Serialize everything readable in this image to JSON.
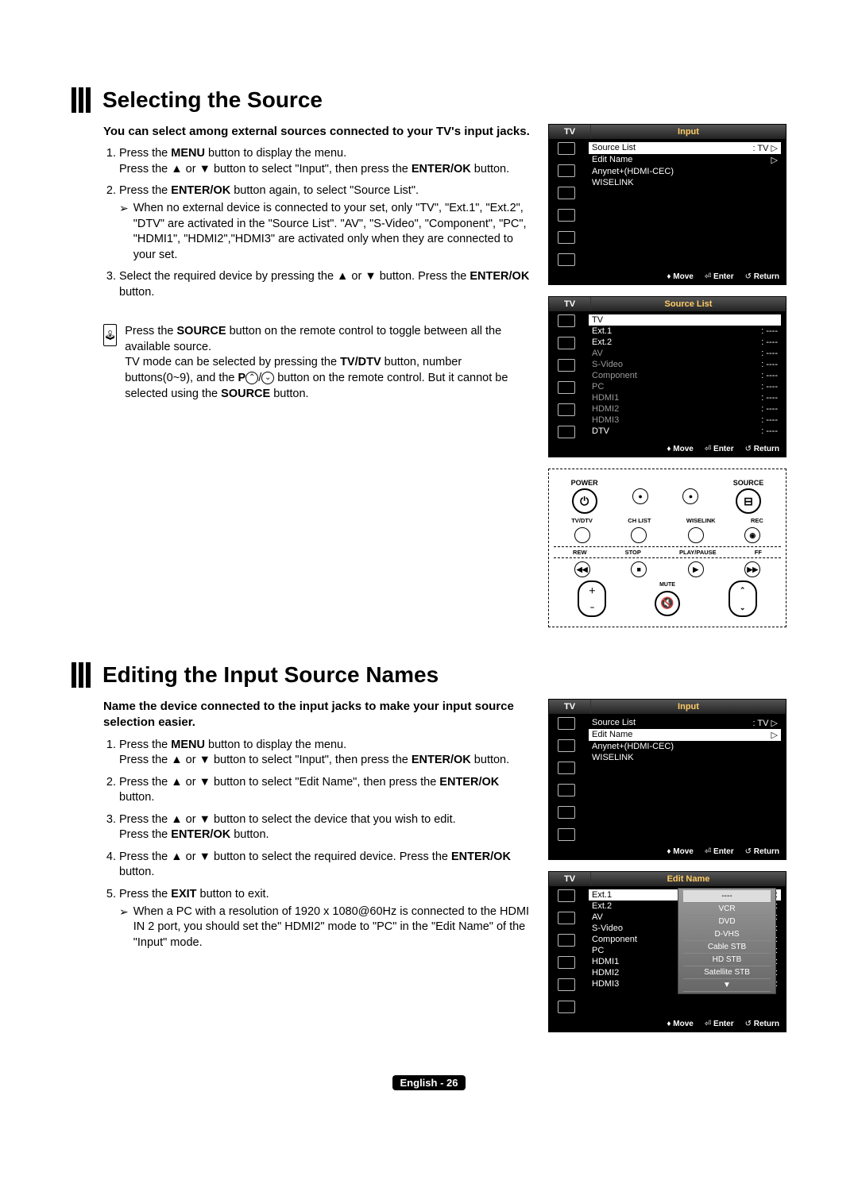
{
  "sec1": {
    "title": "Selecting the Source",
    "intro": "You can select among external sources connected to your TV's input jacks.",
    "step1a": "Press the ",
    "step1a_b": "MENU",
    "step1a2": " button to display the menu.",
    "step1b": "Press the ▲ or ▼ button to select \"Input\", then press the ",
    "step1b_b": "ENTER/OK",
    "step1b2": " button.",
    "step2a": "Press the ",
    "step2a_b": "ENTER/OK",
    "step2a2": " button again, to select \"Source List\".",
    "step2sub": "When no external device is connected to your set, only \"TV\", \"Ext.1\", \"Ext.2\", \"DTV\" are activated in the \"Source List\". \"AV\", \"S-Video\", \"Component\", \"PC\", \"HDMI1\", \"HDMI2\",\"HDMI3\" are activated only when they are connected to your set.",
    "step3a": "Select the required device by pressing the ▲ or ▼ button. Press the ",
    "step3a_b": "ENTER/OK",
    "step3a2": " button.",
    "note1a": "Press the ",
    "note1a_b": "SOURCE",
    "note1a2": " button on the remote control to toggle between all the available source.",
    "note1b1": "TV mode can be selected by pressing the ",
    "note1b1_b": "TV/DTV",
    "note1b2": " button, number buttons(0~9), and the ",
    "note1b2_b": "P",
    "note1b3": " button on the remote control. But it cannot be selected using the ",
    "note1b3_b": "SOURCE",
    "note1b4": " button."
  },
  "sec2": {
    "title": "Editing the Input Source Names",
    "intro": "Name the device connected to the input jacks to make your input source selection easier.",
    "step1a": "Press the ",
    "step1a_b": "MENU",
    "step1a2": " button to display the menu.",
    "step1b": "Press the ▲ or ▼ button to select \"Input\", then press the ",
    "step1b_b": "ENTER/OK",
    "step1b2": " button.",
    "step2": "Press the ▲ or ▼ button to select \"Edit Name\", then press the ",
    "step2_b": "ENTER/OK",
    "step2_2": " button.",
    "step3a": "Press the ▲ or ▼ button to select the device that you wish to edit.",
    "step3b": "Press the ",
    "step3b_b": "ENTER/OK",
    "step3b2": " button.",
    "step4": "Press the ▲ or ▼ button to select the required device. Press the ",
    "step4_b": "ENTER/OK",
    "step4_2": " button.",
    "step5": "Press the ",
    "step5_b": "EXIT",
    "step5_2": " button to exit.",
    "step5sub": "When a PC with a resolution of 1920 x 1080@60Hz is connected to the HDMI IN 2 port, you should set the\" HDMI2\" mode to \"PC\" in the \"Edit Name\" of the \"Input\" mode."
  },
  "osd": {
    "tv": "TV",
    "input_title": "Input",
    "source_list_title": "Source List",
    "edit_name_title": "Edit Name",
    "items_input": [
      {
        "label": "Source List",
        "val": ": TV",
        "tri": true,
        "hl": true
      },
      {
        "label": "Edit Name",
        "val": "",
        "tri": true
      },
      {
        "label": "Anynet+(HDMI-CEC)",
        "val": ""
      },
      {
        "label": "WISELINK",
        "val": ""
      }
    ],
    "items_srclist": [
      {
        "label": "TV",
        "val": "",
        "hl": true
      },
      {
        "label": "Ext.1",
        "val": ":   ----"
      },
      {
        "label": "Ext.2",
        "val": ":   ----"
      },
      {
        "label": "AV",
        "val": ":   ----",
        "grey": true
      },
      {
        "label": "S-Video",
        "val": ":   ----",
        "grey": true
      },
      {
        "label": "Component",
        "val": ":   ----",
        "grey": true
      },
      {
        "label": "PC",
        "val": ":   ----",
        "grey": true
      },
      {
        "label": "HDMI1",
        "val": ":   ----",
        "grey": true
      },
      {
        "label": "HDMI2",
        "val": ":   ----",
        "grey": true
      },
      {
        "label": "HDMI3",
        "val": ":   ----",
        "grey": true
      },
      {
        "label": "DTV",
        "val": ":   ----"
      }
    ],
    "items_input2": [
      {
        "label": "Source List",
        "val": ": TV",
        "tri": true
      },
      {
        "label": "Edit Name",
        "val": "",
        "tri": true,
        "hl": true
      },
      {
        "label": "Anynet+(HDMI-CEC)",
        "val": ""
      },
      {
        "label": "WISELINK",
        "val": ""
      }
    ],
    "items_editname": [
      {
        "label": "Ext.1",
        "val": ":",
        "hl": true
      },
      {
        "label": "Ext.2",
        "val": ":"
      },
      {
        "label": "AV",
        "val": ":"
      },
      {
        "label": "S-Video",
        "val": ":"
      },
      {
        "label": "Component",
        "val": ":"
      },
      {
        "label": "PC",
        "val": ":"
      },
      {
        "label": "HDMI1",
        "val": ":"
      },
      {
        "label": "HDMI2",
        "val": ":"
      },
      {
        "label": "HDMI3",
        "val": ":"
      }
    ],
    "dropdown": [
      "----",
      "VCR",
      "DVD",
      "D-VHS",
      "Cable STB",
      "HD STB",
      "Satellite STB",
      "▼"
    ],
    "move": "Move",
    "enter": "Enter",
    "return": "Return"
  },
  "remote": {
    "power": "POWER",
    "source": "SOURCE",
    "row2": [
      "TV/DTV",
      "CH LIST",
      "WISELINK",
      "REC"
    ],
    "row3": [
      "REW",
      "STOP",
      "PLAY/PAUSE",
      "FF"
    ],
    "mute": "MUTE"
  },
  "footer": {
    "lang": "English - 26"
  }
}
